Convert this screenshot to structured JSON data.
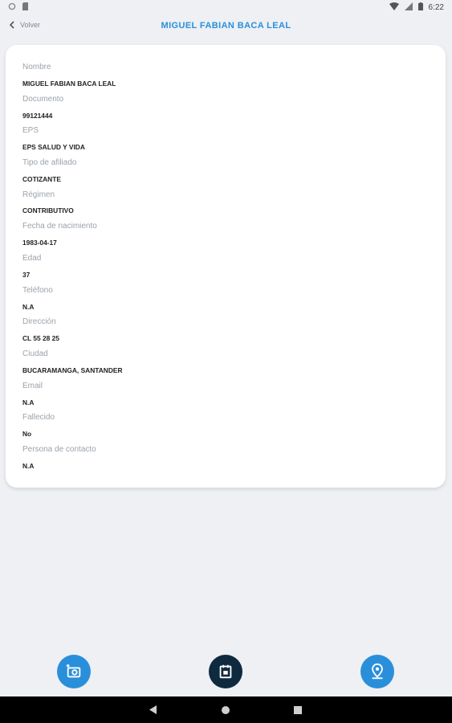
{
  "status_bar": {
    "time": "6:22"
  },
  "header": {
    "back_label": "Volver",
    "title": "MIGUEL FABIAN BACA LEAL"
  },
  "fields": [
    {
      "label": "Nombre",
      "value": "MIGUEL FABIAN BACA LEAL"
    },
    {
      "label": "Documento",
      "value": "99121444"
    },
    {
      "label": "EPS",
      "value": "EPS SALUD Y VIDA"
    },
    {
      "label": "Tipo de afiliado",
      "value": "COTIZANTE"
    },
    {
      "label": "Régimen",
      "value": "CONTRIBUTIVO"
    },
    {
      "label": "Fecha de nacimiento",
      "value": "1983-04-17"
    },
    {
      "label": "Edad",
      "value": "37"
    },
    {
      "label": "Teléfono",
      "value": "N.A"
    },
    {
      "label": "Dirección",
      "value": "CL 55 28 25"
    },
    {
      "label": "Ciudad",
      "value": "BUCARAMANGA, SANTANDER"
    },
    {
      "label": "Email",
      "value": "N.A"
    },
    {
      "label": "Fallecido",
      "value": "No"
    },
    {
      "label": "Persona de contacto",
      "value": "N.A"
    }
  ],
  "actions": {
    "camera_icon": "add-photo-icon",
    "calendar_icon": "calendar-icon",
    "location_icon": "location-pin-icon"
  },
  "colors": {
    "accent": "#2a8fdb",
    "dark_button": "#0f2a3e"
  },
  "nav": {
    "back_icon": "back-triangle-icon",
    "home_icon": "home-circle-icon",
    "recents_icon": "recents-square-icon"
  }
}
